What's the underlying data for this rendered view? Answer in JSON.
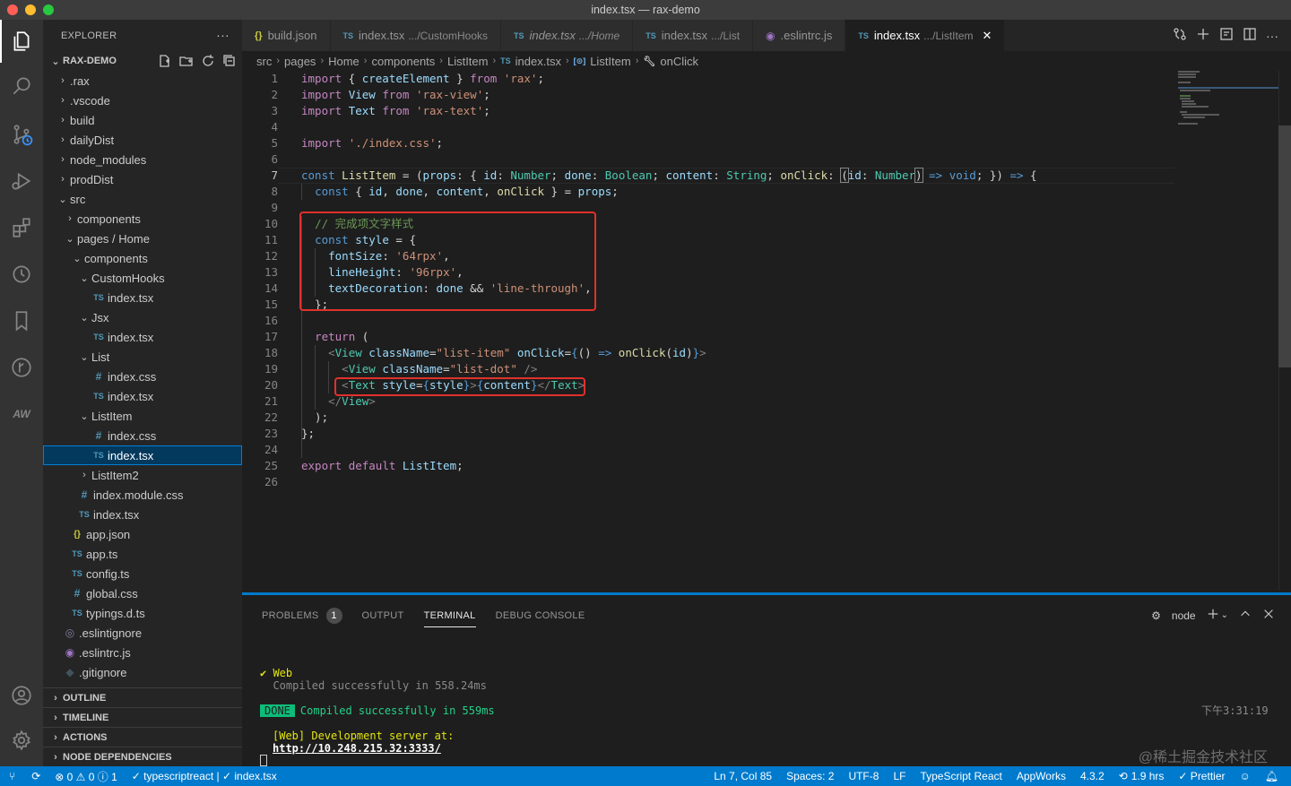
{
  "window": {
    "title": "index.tsx — rax-demo"
  },
  "activity_bar": {
    "icons": [
      "files-icon",
      "search-icon",
      "source-control-icon",
      "run-debug-icon",
      "extensions-icon",
      "timeline-icon",
      "bookmark-icon",
      "git-graph-icon",
      "appworks-icon",
      "account-icon",
      "settings-gear-icon"
    ],
    "appworks_label": "AW"
  },
  "explorer": {
    "header": "EXPLORER",
    "more": "···",
    "project": "RAX-DEMO",
    "tree": [
      {
        "label": ".rax",
        "depth": 0,
        "type": "folder",
        "open": false
      },
      {
        "label": ".vscode",
        "depth": 0,
        "type": "folder",
        "open": false
      },
      {
        "label": "build",
        "depth": 0,
        "type": "folder",
        "open": false
      },
      {
        "label": "dailyDist",
        "depth": 0,
        "type": "folder",
        "open": false
      },
      {
        "label": "node_modules",
        "depth": 0,
        "type": "folder",
        "open": false
      },
      {
        "label": "prodDist",
        "depth": 0,
        "type": "folder",
        "open": false
      },
      {
        "label": "src",
        "depth": 0,
        "type": "folder",
        "open": true
      },
      {
        "label": "components",
        "depth": 1,
        "type": "folder",
        "open": false
      },
      {
        "label": "pages / Home",
        "depth": 1,
        "type": "folder",
        "open": true
      },
      {
        "label": "components",
        "depth": 2,
        "type": "folder",
        "open": true
      },
      {
        "label": "CustomHooks",
        "depth": 3,
        "type": "folder",
        "open": true
      },
      {
        "label": "index.tsx",
        "depth": 4,
        "type": "ts"
      },
      {
        "label": "Jsx",
        "depth": 3,
        "type": "folder",
        "open": true
      },
      {
        "label": "index.tsx",
        "depth": 4,
        "type": "ts"
      },
      {
        "label": "List",
        "depth": 3,
        "type": "folder",
        "open": true
      },
      {
        "label": "index.css",
        "depth": 4,
        "type": "css"
      },
      {
        "label": "index.tsx",
        "depth": 4,
        "type": "ts"
      },
      {
        "label": "ListItem",
        "depth": 3,
        "type": "folder",
        "open": true
      },
      {
        "label": "index.css",
        "depth": 4,
        "type": "css"
      },
      {
        "label": "index.tsx",
        "depth": 4,
        "type": "ts",
        "selected": true
      },
      {
        "label": "ListItem2",
        "depth": 3,
        "type": "folder",
        "open": false
      },
      {
        "label": "index.module.css",
        "depth": 2,
        "type": "css"
      },
      {
        "label": "index.tsx",
        "depth": 2,
        "type": "ts"
      },
      {
        "label": "app.json",
        "depth": 1,
        "type": "json"
      },
      {
        "label": "app.ts",
        "depth": 1,
        "type": "ts"
      },
      {
        "label": "config.ts",
        "depth": 1,
        "type": "ts"
      },
      {
        "label": "global.css",
        "depth": 1,
        "type": "css"
      },
      {
        "label": "typings.d.ts",
        "depth": 1,
        "type": "ts"
      },
      {
        "label": ".eslintignore",
        "depth": 0,
        "type": "eslint"
      },
      {
        "label": ".eslintrc.js",
        "depth": 0,
        "type": "eslintrc"
      },
      {
        "label": ".gitignore",
        "depth": 0,
        "type": "git"
      }
    ],
    "sections": [
      "OUTLINE",
      "TIMELINE",
      "ACTIONS",
      "NODE DEPENDENCIES"
    ]
  },
  "tabs": [
    {
      "icon": "{}",
      "icon_type": "json",
      "label": "build.json",
      "desc": "",
      "italic": false
    },
    {
      "icon": "TS",
      "icon_type": "ts",
      "label": "index.tsx",
      "desc": ".../CustomHooks",
      "italic": false
    },
    {
      "icon": "TS",
      "icon_type": "ts",
      "label": "index.tsx",
      "desc": ".../Home",
      "italic": true
    },
    {
      "icon": "TS",
      "icon_type": "ts",
      "label": "index.tsx",
      "desc": ".../List",
      "italic": false
    },
    {
      "icon": "◉",
      "icon_type": "es",
      "label": ".eslintrc.js",
      "desc": "",
      "italic": false
    },
    {
      "icon": "TS",
      "icon_type": "ts",
      "label": "index.tsx",
      "desc": ".../ListItem",
      "italic": false,
      "active": true
    }
  ],
  "breadcrumb": [
    "src",
    "pages",
    "Home",
    "components",
    "ListItem",
    "index.tsx",
    "ListItem",
    "onClick"
  ],
  "code": {
    "lines": [
      "1",
      "2",
      "3",
      "4",
      "5",
      "6",
      "7",
      "8",
      "9",
      "10",
      "11",
      "12",
      "13",
      "14",
      "15",
      "16",
      "17",
      "18",
      "19",
      "20",
      "21",
      "22",
      "23",
      "24",
      "25",
      "26"
    ],
    "current_line": 7
  },
  "panel": {
    "tabs": [
      {
        "label": "PROBLEMS",
        "badge": "1"
      },
      {
        "label": "OUTPUT"
      },
      {
        "label": "TERMINAL",
        "active": true
      },
      {
        "label": "DEBUG CONSOLE"
      }
    ],
    "terminal_profile": "node",
    "terminal": {
      "web_label": "✔ Web",
      "web_compiled": "  Compiled successfully in 558.24ms",
      "done_badge": "DONE",
      "done_text": "Compiled successfully in 559ms",
      "timestamp": "下午3:31:19",
      "dev_server": "[Web] Development server at:",
      "url": "http://10.248.215.32:3333/"
    },
    "watermark": "@稀土掘金技术社区"
  },
  "statusbar": {
    "problems": "⊗ 0 ⚠ 0 ⓘ 1",
    "lang_check": "✓ typescriptreact | ✓ index.tsx",
    "position": "Ln 7, Col 85",
    "spaces": "Spaces: 2",
    "encoding": "UTF-8",
    "eol": "LF",
    "language": "TypeScript React",
    "appworks": "AppWorks",
    "ts_version": "4.3.2",
    "time": "1.9 hrs",
    "prettier": "✓ Prettier"
  },
  "colors": {
    "accent": "#007acc",
    "highlight_box": "#e0312c"
  }
}
